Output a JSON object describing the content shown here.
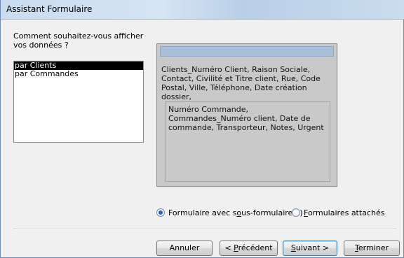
{
  "window": {
    "title": "Assistant Formulaire"
  },
  "prompt": "Comment souhaitez-vous afficher vos données ?",
  "list": {
    "items": [
      {
        "label": "par Clients",
        "selected": true
      },
      {
        "label": "par Commandes",
        "selected": false
      }
    ]
  },
  "preview": {
    "main_fields": "Clients_Numéro Client, Raison Sociale, Contact, Civilité et Titre client, Rue, Code Postal, Ville, Téléphone, Date création dossier,",
    "sub_fields": "Numéro Commande, Commandes_Numéro client, Date de commande, Transporteur, Notes, Urgent"
  },
  "options": {
    "subform": {
      "pre": "Formulaire avec s",
      "key": "o",
      "post": "us-formulaire(s)",
      "checked": true
    },
    "linked": {
      "pre": "",
      "key": "F",
      "post": "ormulaires attachés",
      "checked": false
    }
  },
  "buttons": {
    "cancel": {
      "pre": "Annuler",
      "key": "",
      "post": ""
    },
    "previous": {
      "pre": "< ",
      "key": "P",
      "post": "récédent"
    },
    "next": {
      "pre": "",
      "key": "S",
      "post": "uivant >"
    },
    "finish": {
      "pre": "",
      "key": "T",
      "post": "erminer"
    }
  }
}
